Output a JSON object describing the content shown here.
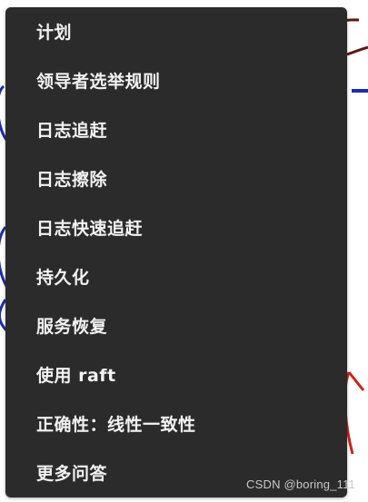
{
  "menu": {
    "items": [
      {
        "label": "计划"
      },
      {
        "label": "领导者选举规则"
      },
      {
        "label": "日志追赶"
      },
      {
        "label": "日志擦除"
      },
      {
        "label": "日志快速追赶"
      },
      {
        "label": "持久化"
      },
      {
        "label": "服务恢复"
      },
      {
        "label": "使用 raft"
      },
      {
        "label": "正确性：线性一致性"
      },
      {
        "label": "更多问答"
      }
    ]
  },
  "watermark": "CSDN @boring_111",
  "colors": {
    "panel_bg": "#2b2b2b",
    "text": "#f2f2f2",
    "scribble_blue": "#1f2aa8",
    "scribble_red": "#c8241b"
  }
}
